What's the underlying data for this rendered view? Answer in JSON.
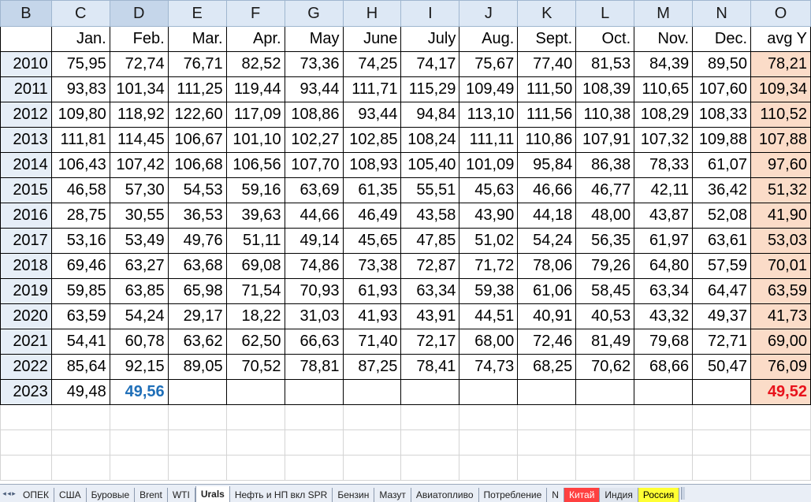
{
  "columns": [
    "B",
    "C",
    "D",
    "E",
    "F",
    "G",
    "H",
    "I",
    "J",
    "K",
    "L",
    "M",
    "N",
    "O"
  ],
  "months": [
    "Jan.",
    "Feb.",
    "Mar.",
    "Apr.",
    "May",
    "June",
    "July",
    "Aug.",
    "Sept.",
    "Oct.",
    "Nov.",
    "Dec.",
    "avg Y"
  ],
  "rows": [
    {
      "year": "2010",
      "values": [
        "75,95",
        "72,74",
        "76,71",
        "82,52",
        "73,36",
        "74,25",
        "74,17",
        "75,67",
        "77,40",
        "81,53",
        "84,39",
        "89,50"
      ],
      "avg": "78,21"
    },
    {
      "year": "2011",
      "values": [
        "93,83",
        "101,34",
        "111,25",
        "119,44",
        "93,44",
        "111,71",
        "115,29",
        "109,49",
        "111,50",
        "108,39",
        "110,65",
        "107,60"
      ],
      "avg": "109,34"
    },
    {
      "year": "2012",
      "values": [
        "109,80",
        "118,92",
        "122,60",
        "117,09",
        "108,86",
        "93,44",
        "94,84",
        "113,10",
        "111,56",
        "110,38",
        "108,29",
        "108,33"
      ],
      "avg": "110,52"
    },
    {
      "year": "2013",
      "values": [
        "111,81",
        "114,45",
        "106,67",
        "101,10",
        "102,27",
        "102,85",
        "108,24",
        "111,11",
        "110,86",
        "107,91",
        "107,32",
        "109,88"
      ],
      "avg": "107,88"
    },
    {
      "year": "2014",
      "values": [
        "106,43",
        "107,42",
        "106,68",
        "106,56",
        "107,70",
        "108,93",
        "105,40",
        "101,09",
        "95,84",
        "86,38",
        "78,33",
        "61,07"
      ],
      "avg": "97,60"
    },
    {
      "year": "2015",
      "values": [
        "46,58",
        "57,30",
        "54,53",
        "59,16",
        "63,69",
        "61,35",
        "55,51",
        "45,63",
        "46,66",
        "46,77",
        "42,11",
        "36,42"
      ],
      "avg": "51,32"
    },
    {
      "year": "2016",
      "values": [
        "28,75",
        "30,55",
        "36,53",
        "39,63",
        "44,66",
        "46,49",
        "43,58",
        "43,90",
        "44,18",
        "48,00",
        "43,87",
        "52,08"
      ],
      "avg": "41,90"
    },
    {
      "year": "2017",
      "values": [
        "53,16",
        "53,49",
        "49,76",
        "51,11",
        "49,14",
        "45,65",
        "47,85",
        "51,02",
        "54,24",
        "56,35",
        "61,97",
        "63,61"
      ],
      "avg": "53,03"
    },
    {
      "year": "2018",
      "values": [
        "69,46",
        "63,27",
        "63,68",
        "69,08",
        "74,86",
        "73,38",
        "72,87",
        "71,72",
        "78,06",
        "79,26",
        "64,80",
        "57,59"
      ],
      "avg": "70,01"
    },
    {
      "year": "2019",
      "values": [
        "59,85",
        "63,85",
        "65,98",
        "71,54",
        "70,93",
        "61,93",
        "63,34",
        "59,38",
        "61,06",
        "58,45",
        "63,34",
        "64,47"
      ],
      "avg": "63,59"
    },
    {
      "year": "2020",
      "values": [
        "63,59",
        "54,24",
        "29,17",
        "18,22",
        "31,03",
        "41,93",
        "43,91",
        "44,51",
        "40,91",
        "40,53",
        "43,32",
        "49,37"
      ],
      "avg": "41,73"
    },
    {
      "year": "2021",
      "values": [
        "54,41",
        "60,78",
        "63,62",
        "62,50",
        "66,63",
        "71,40",
        "72,17",
        "68,00",
        "72,46",
        "81,49",
        "79,68",
        "72,71"
      ],
      "avg": "69,00"
    },
    {
      "year": "2022",
      "values": [
        "85,64",
        "92,15",
        "89,05",
        "70,52",
        "78,81",
        "87,25",
        "78,41",
        "74,73",
        "68,25",
        "70,62",
        "68,66",
        "50,47"
      ],
      "avg": "76,09"
    },
    {
      "year": "2023",
      "values": [
        "49,48",
        "49,56",
        "",
        "",
        "",
        "",
        "",
        "",
        "",
        "",
        "",
        ""
      ],
      "avg": "49,52"
    }
  ],
  "sheet_tabs": [
    {
      "label": "ОПЕК",
      "style": ""
    },
    {
      "label": "США",
      "style": ""
    },
    {
      "label": "Буровые",
      "style": ""
    },
    {
      "label": "Brent",
      "style": ""
    },
    {
      "label": "WTI",
      "style": ""
    },
    {
      "label": "Urals",
      "style": "active"
    },
    {
      "label": "Нефть и НП вкл SPR",
      "style": ""
    },
    {
      "label": "Бензин",
      "style": ""
    },
    {
      "label": "Мазут",
      "style": ""
    },
    {
      "label": "Авиатопливо",
      "style": ""
    },
    {
      "label": "Потребление",
      "style": ""
    },
    {
      "label": "N",
      "style": ""
    },
    {
      "label": "Китай",
      "style": "tab-red"
    },
    {
      "label": "Индия",
      "style": "tab-dark"
    },
    {
      "label": "Россия",
      "style": "tab-yellow"
    }
  ],
  "colors": {
    "header": "#dde8f5",
    "avg_fill": "#fbdcc8",
    "highlight_blue": "#1f6fb8",
    "highlight_red": "#e8121b"
  }
}
